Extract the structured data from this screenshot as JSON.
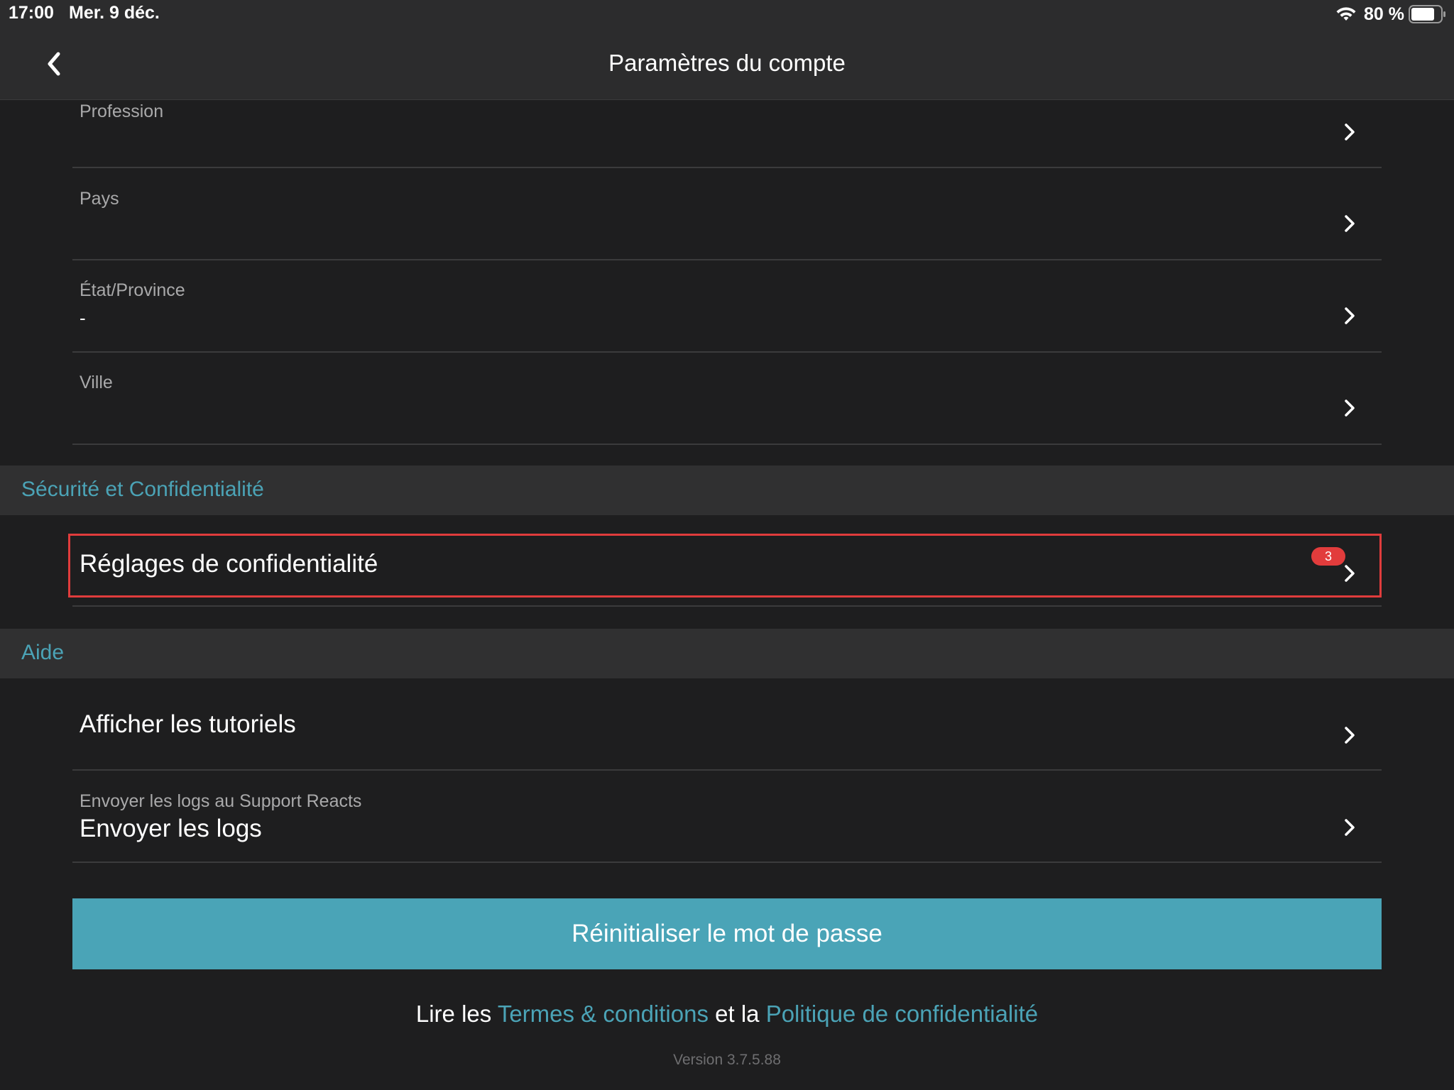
{
  "status_bar": {
    "time": "17:00",
    "date": "Mer. 9 déc.",
    "battery": "80 %",
    "wifi_icon": "wifi-icon",
    "battery_icon": "battery-icon"
  },
  "header": {
    "title": "Paramètres du compte",
    "back_icon": "chevron-left-icon"
  },
  "profile_fields": [
    {
      "label": "Profession",
      "value": ""
    },
    {
      "label": "Pays",
      "value": ""
    },
    {
      "label": "État/Province",
      "value": "-"
    },
    {
      "label": "Ville",
      "value": ""
    }
  ],
  "security_section": {
    "header": "Sécurité et Confidentialité",
    "privacy_settings_label": "Réglages de confidentialité",
    "badge_count": "3"
  },
  "help_section": {
    "header": "Aide",
    "tutorials_label": "Afficher les tutoriels",
    "logs_sublabel": "Envoyer les logs au Support Reacts",
    "logs_label": "Envoyer les logs"
  },
  "reset_password_label": "Réinitialiser le mot de passe",
  "legal": {
    "prefix": "Lire les ",
    "terms_link": "Termes & conditions",
    "middle": " et la ",
    "privacy_link": "Politique de confidentialité"
  },
  "version": "Version 3.7.5.88",
  "colors": {
    "accent": "#4aa4b7",
    "badge": "#e23c3c",
    "highlight_border": "#e03c3c",
    "background": "#1e1e1f",
    "section_header_bg": "#303031"
  }
}
